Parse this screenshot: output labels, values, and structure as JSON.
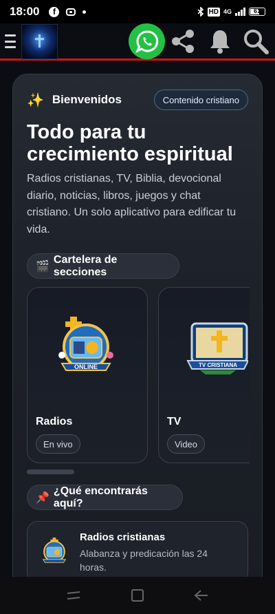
{
  "status_bar": {
    "time": "18:00",
    "network_badge": "HD",
    "network_type": "4G",
    "battery": "61"
  },
  "header": {
    "icons": [
      "menu-icon",
      "app-logo",
      "whatsapp-icon",
      "share-icon",
      "bell-icon",
      "search-icon"
    ],
    "accent_line_color": "#d01515"
  },
  "welcome": {
    "emoji": "✨",
    "title": "Bienvenidos",
    "badge": "Contenido cristiano"
  },
  "hero": {
    "title": "Todo para tu crecimiento espiritual",
    "subtitle": "Radios cristianas, TV, Biblia, devocional diario, noticias, libros, juegos y chat cristiano. Un solo aplicativo para edificar tu vida."
  },
  "sections_chip": {
    "emoji": "🎬",
    "label": "Cartelera de secciones"
  },
  "tiles": [
    {
      "name": "Radios",
      "tag": "En vivo",
      "image": "radio-online-emblem"
    },
    {
      "name": "TV",
      "tag": "Video",
      "image": "tv-cristiana-emblem"
    }
  ],
  "features_chip": {
    "emoji": "📌",
    "label": "¿Qué encontrarás aquí?"
  },
  "features": [
    {
      "title": "Radios cristianas",
      "description": "Alabanza y predicación las 24 horas.",
      "image": "radio-online-emblem"
    }
  ],
  "colors": {
    "whatsapp": "#24c046",
    "badge_border": "#4b6a8c",
    "card_bg": "#1d2129"
  }
}
